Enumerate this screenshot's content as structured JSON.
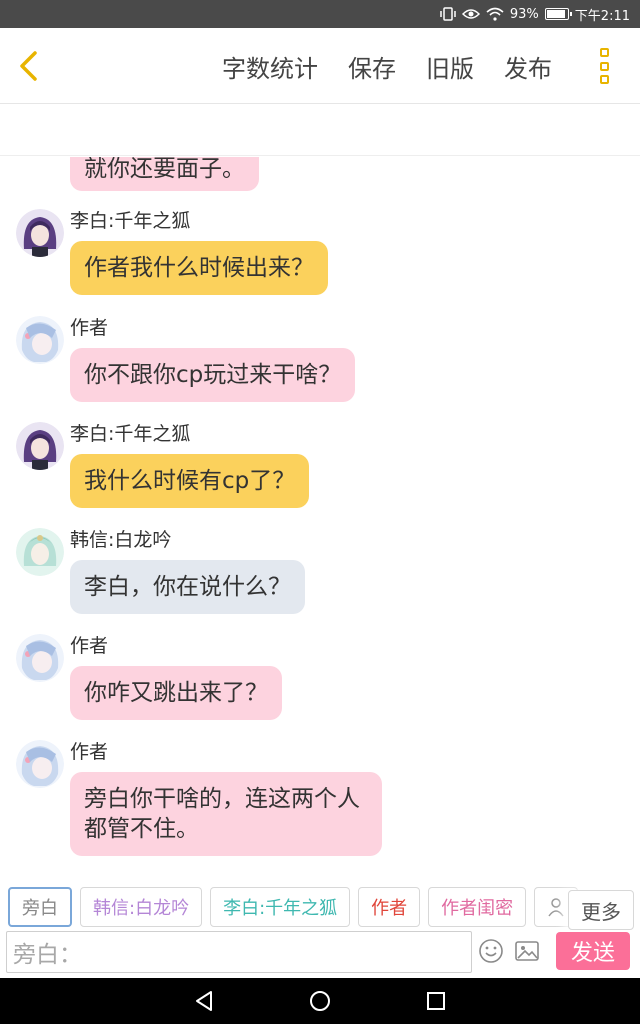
{
  "status_bar": {
    "battery": "93%",
    "battery_level": 0.93,
    "time": "下午2:11",
    "icons": [
      "vibrate-icon",
      "eye-icon",
      "wifi-icon",
      "battery-icon"
    ]
  },
  "header": {
    "back_icon": "chevron-left-icon",
    "actions": [
      "字数统计",
      "保存",
      "旧版",
      "发布"
    ],
    "more_icon": "more-vertical-icon",
    "accent": "#e8b400"
  },
  "messages": {
    "partial": "就你还要面子。",
    "items": [
      {
        "name": "李白:千年之狐",
        "text": "作者我什么时候出来？",
        "style": "yellow"
      },
      {
        "name": "作者",
        "text": "你不跟你cp玩过来干啥？",
        "style": "pink"
      },
      {
        "name": "李白:千年之狐",
        "text": "我什么时候有cp了？",
        "style": "yellow"
      },
      {
        "name": "韩信:白龙吟",
        "text": "李白，你在说什么？",
        "style": "gray"
      },
      {
        "name": "作者",
        "text": "你咋又跳出来了？",
        "style": "pink"
      },
      {
        "name": "作者",
        "text": "旁白你干啥的，连这两个人都管不住。",
        "style": "pink"
      }
    ]
  },
  "characters": {
    "chips": [
      {
        "label": "旁白",
        "color": "#888888"
      },
      {
        "label": "韩信:白龙吟",
        "color": "#b486d6"
      },
      {
        "label": "李白:千年之狐",
        "color": "#3fb8b0"
      },
      {
        "label": "作者",
        "color": "#e0453a"
      },
      {
        "label": "作者闺密",
        "color": "#e06aa0"
      }
    ],
    "more_label": "更多"
  },
  "composer": {
    "placeholder": "旁白：",
    "send_label": "发送",
    "send_color": "#fb6f98"
  },
  "nav": {
    "icons": [
      "back-triangle-icon",
      "home-circle-icon",
      "recents-square-icon"
    ]
  }
}
